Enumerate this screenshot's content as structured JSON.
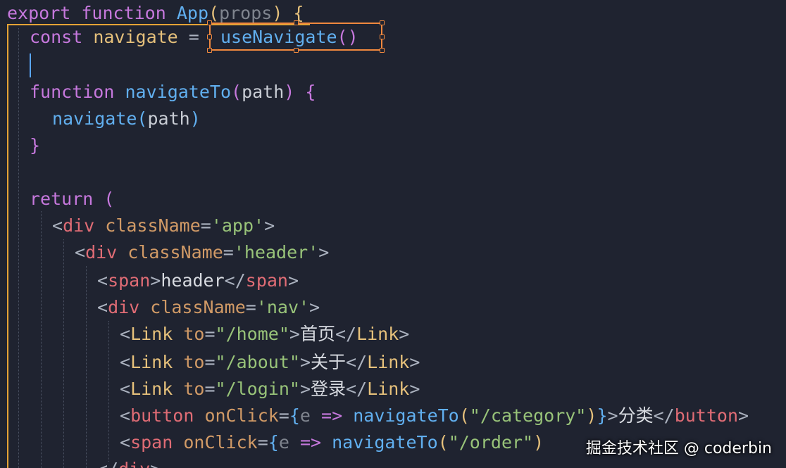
{
  "code_lines": [
    {
      "tokens": [
        [
          "export",
          "kw"
        ],
        [
          " ",
          "plain"
        ],
        [
          "function",
          "kw"
        ],
        [
          " ",
          "plain"
        ],
        [
          "App",
          "fn"
        ],
        [
          "(",
          "paren-y"
        ],
        [
          "props",
          "dim"
        ],
        [
          ")",
          "paren-y"
        ],
        [
          " ",
          "plain"
        ],
        [
          "{",
          "paren-y"
        ]
      ]
    },
    {
      "tokens": [
        [
          "const",
          "kw"
        ],
        [
          " ",
          "plain"
        ],
        [
          "navigate",
          "var"
        ],
        [
          " =",
          "punct"
        ],
        [
          "  ",
          "plain"
        ],
        [
          "useNavigate",
          "fn"
        ],
        [
          "()",
          "paren-p"
        ]
      ]
    },
    {
      "tokens": []
    },
    {
      "tokens": [
        [
          "function",
          "kw"
        ],
        [
          " ",
          "plain"
        ],
        [
          "navigateTo",
          "fn"
        ],
        [
          "(",
          "paren-p"
        ],
        [
          "path",
          "plain"
        ],
        [
          ")",
          "paren-p"
        ],
        [
          " ",
          "plain"
        ],
        [
          "{",
          "paren-p"
        ]
      ]
    },
    {
      "tokens": [
        [
          "navigate",
          "fn"
        ],
        [
          "(",
          "paren-b"
        ],
        [
          "path",
          "plain"
        ],
        [
          ")",
          "paren-b"
        ]
      ]
    },
    {
      "tokens": [
        [
          "}",
          "paren-p"
        ]
      ]
    },
    {
      "tokens": []
    },
    {
      "tokens": [
        [
          "return",
          "kw"
        ],
        [
          " ",
          "plain"
        ],
        [
          "(",
          "paren-p"
        ]
      ]
    },
    {
      "tokens": [
        [
          "<",
          "punct"
        ],
        [
          "div",
          "tag"
        ],
        [
          " ",
          "plain"
        ],
        [
          "className",
          "attr"
        ],
        [
          "=",
          "punct"
        ],
        [
          "'app'",
          "str"
        ],
        [
          ">",
          "punct"
        ]
      ]
    },
    {
      "tokens": [
        [
          "<",
          "punct"
        ],
        [
          "div",
          "tag"
        ],
        [
          " ",
          "plain"
        ],
        [
          "className",
          "attr"
        ],
        [
          "=",
          "punct"
        ],
        [
          "'header'",
          "str"
        ],
        [
          ">",
          "punct"
        ]
      ]
    },
    {
      "tokens": [
        [
          "<",
          "punct"
        ],
        [
          "span",
          "tag"
        ],
        [
          ">",
          "punct"
        ],
        [
          "header",
          "text"
        ],
        [
          "</",
          "punct"
        ],
        [
          "span",
          "tag"
        ],
        [
          ">",
          "punct"
        ]
      ]
    },
    {
      "tokens": [
        [
          "<",
          "punct"
        ],
        [
          "div",
          "tag"
        ],
        [
          " ",
          "plain"
        ],
        [
          "className",
          "attr"
        ],
        [
          "=",
          "punct"
        ],
        [
          "'nav'",
          "str"
        ],
        [
          ">",
          "punct"
        ]
      ]
    },
    {
      "tokens": [
        [
          "<",
          "punct"
        ],
        [
          "Link",
          "comp"
        ],
        [
          " ",
          "plain"
        ],
        [
          "to",
          "attr"
        ],
        [
          "=",
          "punct"
        ],
        [
          "\"/home\"",
          "str"
        ],
        [
          ">",
          "punct"
        ],
        [
          "首页",
          "text"
        ],
        [
          "</",
          "punct"
        ],
        [
          "Link",
          "comp"
        ],
        [
          ">",
          "punct"
        ]
      ]
    },
    {
      "tokens": [
        [
          "<",
          "punct"
        ],
        [
          "Link",
          "comp"
        ],
        [
          " ",
          "plain"
        ],
        [
          "to",
          "attr"
        ],
        [
          "=",
          "punct"
        ],
        [
          "\"/about\"",
          "str"
        ],
        [
          ">",
          "punct"
        ],
        [
          "关于",
          "text"
        ],
        [
          "</",
          "punct"
        ],
        [
          "Link",
          "comp"
        ],
        [
          ">",
          "punct"
        ]
      ]
    },
    {
      "tokens": [
        [
          "<",
          "punct"
        ],
        [
          "Link",
          "comp"
        ],
        [
          " ",
          "plain"
        ],
        [
          "to",
          "attr"
        ],
        [
          "=",
          "punct"
        ],
        [
          "\"/login\"",
          "str"
        ],
        [
          ">",
          "punct"
        ],
        [
          "登录",
          "text"
        ],
        [
          "</",
          "punct"
        ],
        [
          "Link",
          "comp"
        ],
        [
          ">",
          "punct"
        ]
      ]
    },
    {
      "tokens": [
        [
          "<",
          "punct"
        ],
        [
          "button",
          "tag"
        ],
        [
          " ",
          "plain"
        ],
        [
          "onClick",
          "attr"
        ],
        [
          "=",
          "punct"
        ],
        [
          "{",
          "paren-b"
        ],
        [
          "e",
          "dim"
        ],
        [
          " ",
          "plain"
        ],
        [
          "=>",
          "kw"
        ],
        [
          " ",
          "plain"
        ],
        [
          "navigateTo",
          "fn"
        ],
        [
          "(",
          "paren-y"
        ],
        [
          "\"/category\"",
          "str"
        ],
        [
          ")",
          "paren-y"
        ],
        [
          "}",
          "paren-b"
        ],
        [
          ">",
          "punct"
        ],
        [
          "分类",
          "text"
        ],
        [
          "</",
          "punct"
        ],
        [
          "button",
          "tag"
        ],
        [
          ">",
          "punct"
        ]
      ]
    },
    {
      "tokens": [
        [
          "<",
          "punct"
        ],
        [
          "span",
          "tag"
        ],
        [
          " ",
          "plain"
        ],
        [
          "onClick",
          "attr"
        ],
        [
          "=",
          "punct"
        ],
        [
          "{",
          "paren-b"
        ],
        [
          "e",
          "dim"
        ],
        [
          " ",
          "plain"
        ],
        [
          "=>",
          "kw"
        ],
        [
          " ",
          "plain"
        ],
        [
          "navigateTo",
          "fn"
        ],
        [
          "(",
          "paren-y"
        ],
        [
          "\"/order\"",
          "str"
        ],
        [
          ")",
          "paren-y"
        ]
      ]
    },
    {
      "tokens": [
        [
          "</",
          "punct"
        ],
        [
          "div",
          "tag"
        ],
        [
          ">",
          "punct"
        ]
      ]
    }
  ],
  "watermark": "掘金技术社区 @ coderbin",
  "colors": {
    "background": "#1f2330",
    "selection_border": "#f0883e",
    "block_indicator": "#e5a335",
    "cursor": "#5aa7ff"
  }
}
